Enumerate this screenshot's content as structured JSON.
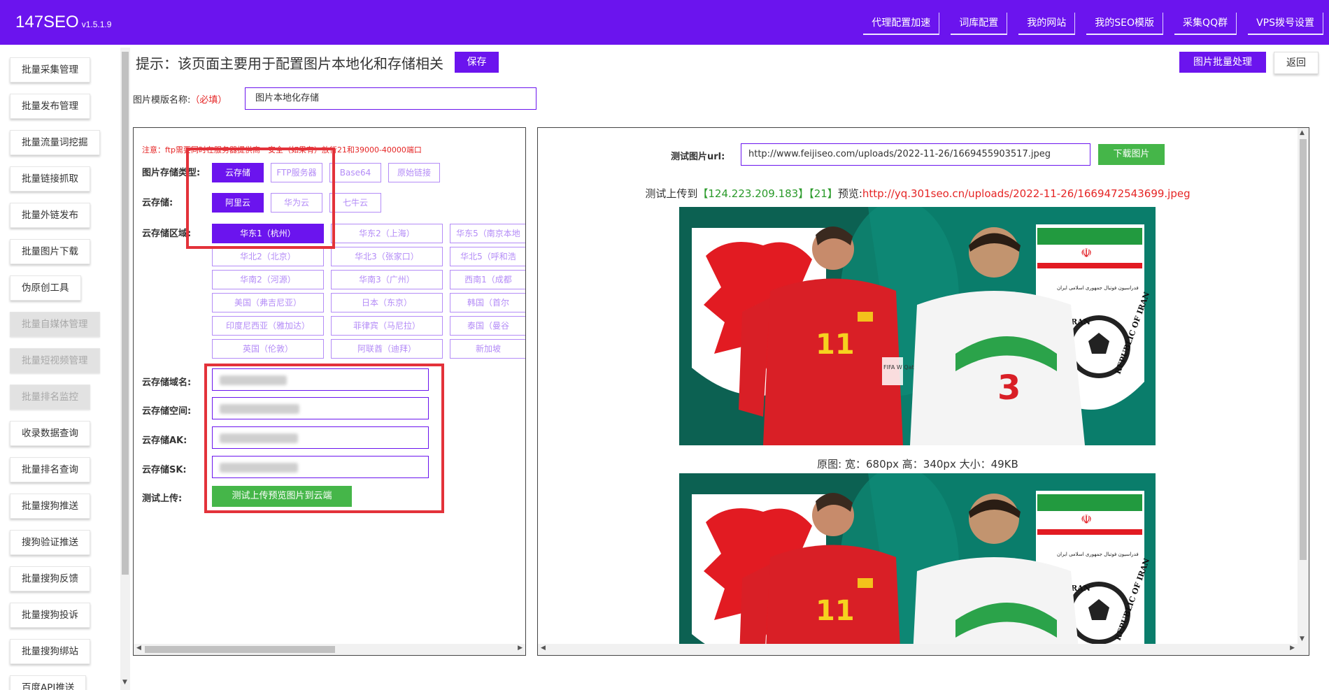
{
  "app": {
    "name": "147SEO",
    "version": "v1.5.1.9"
  },
  "topnav": [
    "代理配置加速",
    "词库配置",
    "我的网站",
    "我的SEO模版",
    "采集QQ群",
    "VPS拨号设置"
  ],
  "sidebar": [
    {
      "label": "批量采集管理",
      "disabled": false
    },
    {
      "label": "批量发布管理",
      "disabled": false
    },
    {
      "label": "批量流量词挖掘",
      "disabled": false
    },
    {
      "label": "批量链接抓取",
      "disabled": false
    },
    {
      "label": "批量外链发布",
      "disabled": false
    },
    {
      "label": "批量图片下载",
      "disabled": false
    },
    {
      "label": "伪原创工具",
      "disabled": false
    },
    {
      "label": "批量自媒体管理",
      "disabled": true
    },
    {
      "label": "批量短视频管理",
      "disabled": true
    },
    {
      "label": "批量排名监控",
      "disabled": true
    },
    {
      "label": "收录数据查询",
      "disabled": false
    },
    {
      "label": "批量排名查询",
      "disabled": false
    },
    {
      "label": "批量搜狗推送",
      "disabled": false
    },
    {
      "label": "搜狗验证推送",
      "disabled": false
    },
    {
      "label": "批量搜狗反馈",
      "disabled": false
    },
    {
      "label": "批量搜狗投诉",
      "disabled": false
    },
    {
      "label": "批量搜狗绑站",
      "disabled": false
    },
    {
      "label": "百度API推送",
      "disabled": false
    }
  ],
  "header": {
    "hint": "提示：该页面主要用于配置图片本地化和存储相关",
    "save_label": "保存",
    "batch_label": "图片批量处理",
    "back_label": "返回"
  },
  "template": {
    "label": "图片模版名称:",
    "required": "（必填）",
    "value": "图片本地化存储"
  },
  "left": {
    "note": "注意：ftp需要同时在服务器提供商一安全（如果有）放行21和39000-40000端口",
    "storage_type_label": "图片存储类型:",
    "storage_types": [
      {
        "label": "云存储",
        "active": true
      },
      {
        "label": "FTP服务器",
        "active": false
      },
      {
        "label": "Base64",
        "active": false
      },
      {
        "label": "原始链接",
        "active": false
      }
    ],
    "cloud_label": "云存储:",
    "clouds": [
      {
        "label": "阿里云",
        "active": true
      },
      {
        "label": "华为云",
        "active": false
      },
      {
        "label": "七牛云",
        "active": false
      }
    ],
    "region_label": "云存储区域:",
    "regions": [
      [
        "华东1（杭州）",
        "华东2（上海）",
        "华东5（南京本地"
      ],
      [
        "华北2（北京）",
        "华北3（张家口）",
        "华北5（呼和浩"
      ],
      [
        "华南2（河源）",
        "华南3（广州）",
        "西南1（成都"
      ],
      [
        "美国（弗吉尼亚）",
        "日本（东京）",
        "韩国（首尔"
      ],
      [
        "印度尼西亚（雅加达）",
        "菲律宾（马尼拉）",
        "泰国（曼谷"
      ],
      [
        "英国（伦敦）",
        "阿联酋（迪拜）",
        "新加坡"
      ]
    ],
    "active_region": "华东1（杭州）",
    "domain_label": "云存储域名:",
    "space_label": "云存储空间:",
    "ak_label": "云存储AK:",
    "sk_label": "云存储SK:",
    "test_label": "测试上传:",
    "upload_btn": "测试上传预览图片到云端"
  },
  "right": {
    "url_label": "测试图片url:",
    "url_value": "http://www.feijiseo.com/uploads/2022-11-26/1669455903517.jpeg",
    "download_btn": "下载图片",
    "preview_prefix": "测试上传到",
    "preview_ip": "【124.223.209.183】",
    "preview_port": "【21】",
    "preview_mid": "预览:",
    "preview_url": "http://yq.301seo.cn/uploads/2022-11-26/1669472543699.jpeg",
    "meta": "原图: 宽：680px 高：340px 大小：49KB",
    "jersey_left": "11",
    "jersey_right": "3",
    "crest_text": "IRAN",
    "crest_arc": "REPUBLIC OF IRAN",
    "persian_text": "فدراسيون فوتبال جمهوری اسلامی ايران",
    "fifa_text": "FIFA W Qat"
  },
  "colors": {
    "accent": "#6b14ee",
    "green": "#45b649",
    "red": "#e3323a",
    "note_red": "#e52525"
  }
}
